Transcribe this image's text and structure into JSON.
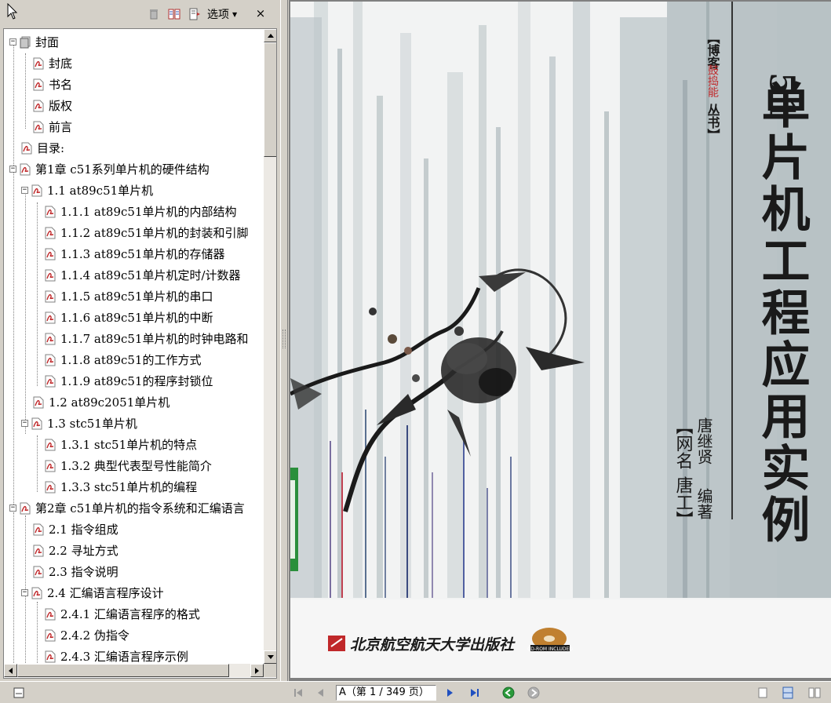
{
  "toolbar": {
    "options_label": "选项",
    "close_label": "×"
  },
  "bookmarks": {
    "items": [
      {
        "label": "封面"
      },
      {
        "label": "封底"
      },
      {
        "label": "书名"
      },
      {
        "label": "版权"
      },
      {
        "label": "前言"
      },
      {
        "label": "目录:"
      },
      {
        "label": "第1章 c51系列单片机的硬件结构"
      },
      {
        "label": "1.1 at89c51单片机"
      },
      {
        "label": "1.1.1 at89c51单片机的内部结构"
      },
      {
        "label": "1.1.2 at89c51单片机的封装和引脚"
      },
      {
        "label": "1.1.3 at89c51单片机的存储器"
      },
      {
        "label": "1.1.4 at89c51单片机定时/计数器"
      },
      {
        "label": "1.1.5 at89c51单片机的串口"
      },
      {
        "label": "1.1.6 at89c51单片机的中断"
      },
      {
        "label": "1.1.7 at89c51单片机的时钟电路和"
      },
      {
        "label": "1.1.8 at89c51的工作方式"
      },
      {
        "label": "1.1.9 at89c51的程序封锁位"
      },
      {
        "label": "1.2 at89c2051单片机"
      },
      {
        "label": "1.3 stc51单片机"
      },
      {
        "label": "1.3.1 stc51单片机的特点"
      },
      {
        "label": "1.3.2 典型代表型号性能简介"
      },
      {
        "label": "1.3.3 stc51单片机的编程"
      },
      {
        "label": "第2章 c51单片机的指令系统和汇编语言"
      },
      {
        "label": "2.1 指令组成"
      },
      {
        "label": "2.2 寻址方式"
      },
      {
        "label": "2.3 指令说明"
      },
      {
        "label": "2.4 汇编语言程序设计"
      },
      {
        "label": "2.4.1 汇编语言程序的格式"
      },
      {
        "label": "2.4.2 伪指令"
      },
      {
        "label": "2.4.3 汇编语言程序示例"
      }
    ]
  },
  "cover": {
    "series_open": "【博客",
    "series_middle": "鼓捣能",
    "series_close": "丛书】",
    "title_prefix": "51",
    "title": "单片机工程应用实例",
    "author_name": "唐继贤",
    "author_role": "编著",
    "alias_bracket_open": "【网名",
    "alias": "唐工】",
    "publisher": "北京航空航天大学出版社",
    "cd_label": "CD-ROM INCLUDED"
  },
  "statusbar": {
    "page_field": "A（第 1 / 349 页）"
  },
  "colors": {
    "accent_green": "#2a8f3c",
    "pdf_red": "#c0282a",
    "cover_gray": "#a8b4b8"
  }
}
